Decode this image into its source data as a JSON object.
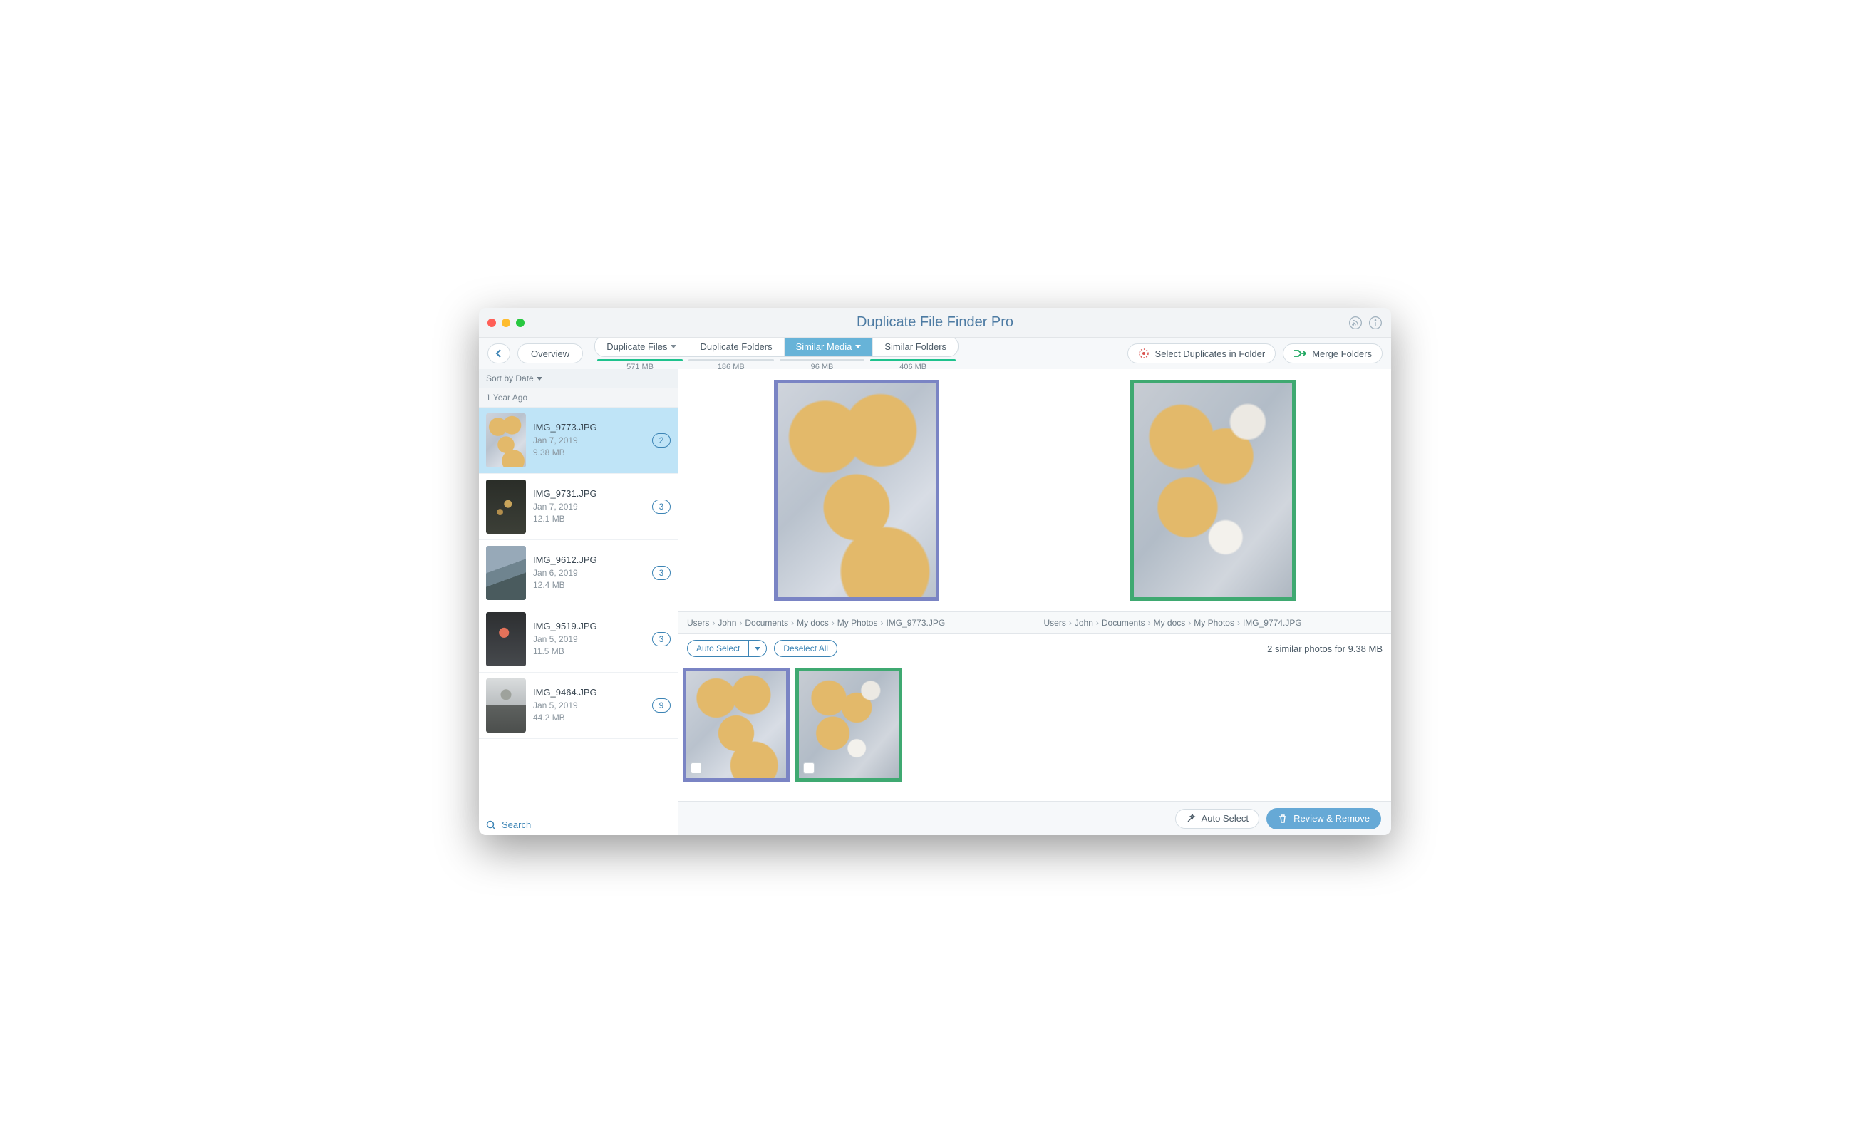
{
  "title": "Duplicate File Finder Pro",
  "toolbar": {
    "overview": "Overview",
    "tabs": [
      {
        "label": "Duplicate Files",
        "meta": "571 MB",
        "fill": 100
      },
      {
        "label": "Duplicate Folders",
        "meta": "186 MB",
        "fill": 0
      },
      {
        "label": "Similar Media",
        "meta": "96 MB",
        "fill": 0,
        "active": true
      },
      {
        "label": "Similar Folders",
        "meta": "406 MB",
        "fill": 100
      }
    ],
    "select_dupes": "Select Duplicates in Folder",
    "merge": "Merge Folders"
  },
  "sidebar": {
    "sort_label": "Sort by Date",
    "group": "1 Year Ago",
    "items": [
      {
        "name": "IMG_9773.JPG",
        "date": "Jan 7, 2019",
        "size": "9.38 MB",
        "count": "2",
        "cls": "ph-cookies",
        "selected": true
      },
      {
        "name": "IMG_9731.JPG",
        "date": "Jan 7, 2019",
        "size": "12.1 MB",
        "count": "3",
        "cls": "ph-dark"
      },
      {
        "name": "IMG_9612.JPG",
        "date": "Jan 6, 2019",
        "size": "12.4 MB",
        "count": "3",
        "cls": "ph-grass"
      },
      {
        "name": "IMG_9519.JPG",
        "date": "Jan 5, 2019",
        "size": "11.5 MB",
        "count": "3",
        "cls": "ph-flower"
      },
      {
        "name": "IMG_9464.JPG",
        "date": "Jan 5, 2019",
        "size": "44.2 MB",
        "count": "9",
        "cls": "ph-tree"
      }
    ],
    "search": "Search"
  },
  "preview": {
    "left_path": [
      "Users",
      "John",
      "Documents",
      "My docs",
      "My Photos",
      "IMG_9773.JPG"
    ],
    "right_path": [
      "Users",
      "John",
      "Documents",
      "My docs",
      "My Photos",
      "IMG_9774.JPG"
    ],
    "border_left": "#7a84c4",
    "border_right": "#3fa971"
  },
  "actions": {
    "auto_select": "Auto Select",
    "deselect": "Deselect All",
    "summary": "2 similar photos for 9.38 MB"
  },
  "footer": {
    "auto_select": "Auto Select",
    "review": "Review & Remove"
  }
}
